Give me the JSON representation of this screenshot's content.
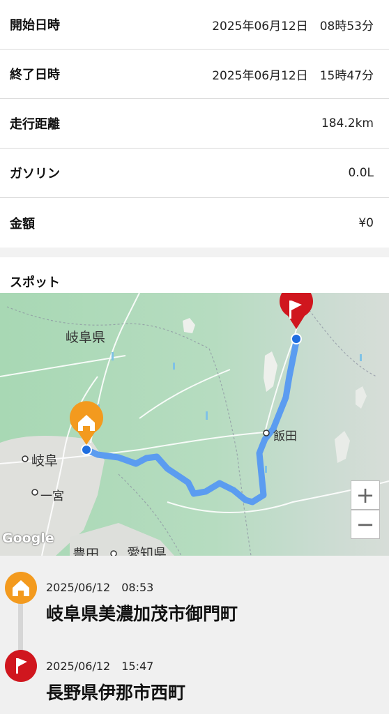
{
  "summary": {
    "start": {
      "label": "開始日時",
      "value": "2025年06月12日　08時53分"
    },
    "end": {
      "label": "終了日時",
      "value": "2025年06月12日　15時47分"
    },
    "distance": {
      "label": "走行距離",
      "value": "184.2km"
    },
    "gasoline": {
      "label": "ガソリン",
      "value": "0.0L"
    },
    "cost": {
      "label": "金額",
      "value": "¥0"
    }
  },
  "spots": {
    "title": "スポット",
    "map": {
      "labels": {
        "gifu_pref": "岐阜県",
        "gifu_city": "岐阜",
        "ichinomiya": "一宮",
        "iida": "飯田",
        "toyota": "豊田",
        "aichi": "愛知県"
      },
      "zoom_in": "+",
      "zoom_out": "−",
      "attribution": "Google"
    },
    "entries": [
      {
        "icon": "home-icon",
        "color": "#f39a1e",
        "time": "2025/06/12　08:53",
        "place": "岐阜県美濃加茂市御門町"
      },
      {
        "icon": "flag-icon",
        "color": "#d0161e",
        "time": "2025/06/12　15:47",
        "place": "長野県伊那市西町"
      }
    ]
  },
  "colors": {
    "route": "#5b9cf0",
    "start_marker": "#f39a1e",
    "end_marker": "#d0161e"
  }
}
